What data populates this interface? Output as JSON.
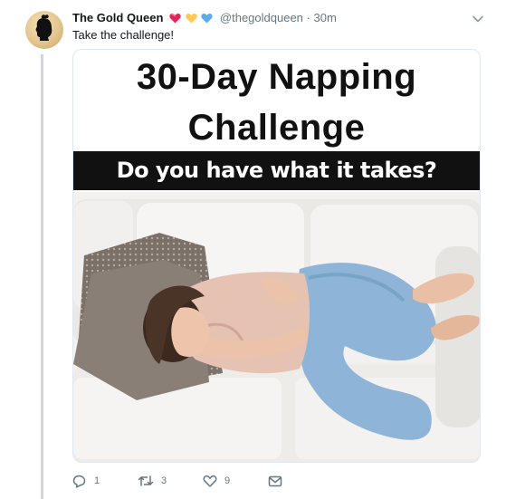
{
  "tweet": {
    "display_name": "The Gold Queen",
    "emojis": [
      "heart-pink-icon",
      "heart-yellow-icon",
      "heart-blue-icon"
    ],
    "handle": "@thegoldqueen",
    "separator": "·",
    "time": "30m",
    "text": "Take the challenge!",
    "media": {
      "headline_line1": "30-Day Napping",
      "headline_line2": "Challenge",
      "banner": "Do you have what it takes?"
    },
    "actions": {
      "replies": "1",
      "retweets": "3",
      "likes": "9"
    }
  },
  "colors": {
    "secondary_text": "#657786",
    "thread_line": "#ccd6dd",
    "banner_bg": "#111111"
  }
}
